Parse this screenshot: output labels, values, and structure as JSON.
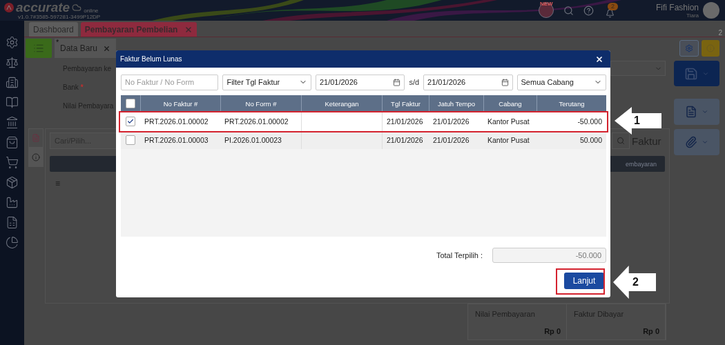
{
  "header": {
    "logo": "accurate",
    "logo_sub": "online",
    "version": "v1.0.7#3585-597281-3499P12DP",
    "new_badge": "NEW",
    "notification_count": "2",
    "company": "Fifi Fashion",
    "user": "Tiara"
  },
  "tabs": [
    {
      "label": "Dashboard",
      "selected": false,
      "closable": false
    },
    {
      "label": "Pembayaran Pembelian",
      "selected": true,
      "closable": true
    }
  ],
  "tab_counter": "2",
  "sub_tabs": [
    {
      "label": "Data Baru",
      "modified_mark": "*"
    }
  ],
  "form": {
    "fields": [
      {
        "label": "Pembayaran ke"
      },
      {
        "label": "Bank",
        "required_mark": "*"
      },
      {
        "label": "Nilai Pembayara"
      }
    ],
    "search_placeholder": "Cari/Pilih...",
    "section_title": "Faktur",
    "grid_header": "embayaran",
    "grid_menu": "≡"
  },
  "summary": [
    {
      "label": "Nilai Pembayaran",
      "value": "Rp 0"
    },
    {
      "label": "Faktur Dibayar",
      "value": "Rp 0"
    }
  ],
  "dialog": {
    "title": "Faktur Belum Lunas",
    "search_placeholder": "No Faktur / No Form",
    "date_filter": "Filter Tgl Faktur",
    "date_from": "21/01/2026",
    "range_separator": "s/d",
    "date_to": "21/01/2026",
    "branch": "Semua Cabang",
    "all_checked": false,
    "columns": [
      "No Faktur #",
      "No Form #",
      "Keterangan",
      "Tgl Faktur",
      "Jatuh Tempo",
      "Cabang",
      "Terutang"
    ],
    "rows": [
      {
        "checked": true,
        "cells": [
          "PRT.2026.01.00002",
          "PRT.2026.01.00002",
          "",
          "21/01/2026",
          "21/01/2026",
          "Kantor Pusat",
          "-50.000"
        ]
      },
      {
        "checked": false,
        "cells": [
          "PRT.2026.01.00003",
          "PI.2026.01.00023",
          "",
          "21/01/2026",
          "21/01/2026",
          "Kantor Pusat",
          "50.000"
        ]
      }
    ],
    "total_label": "Total Terpilih :",
    "total_value": "-50.000",
    "continue_button": "Lanjut"
  },
  "annotations": [
    {
      "kind": "row",
      "number": "1"
    },
    {
      "kind": "button",
      "number": "2"
    }
  ]
}
